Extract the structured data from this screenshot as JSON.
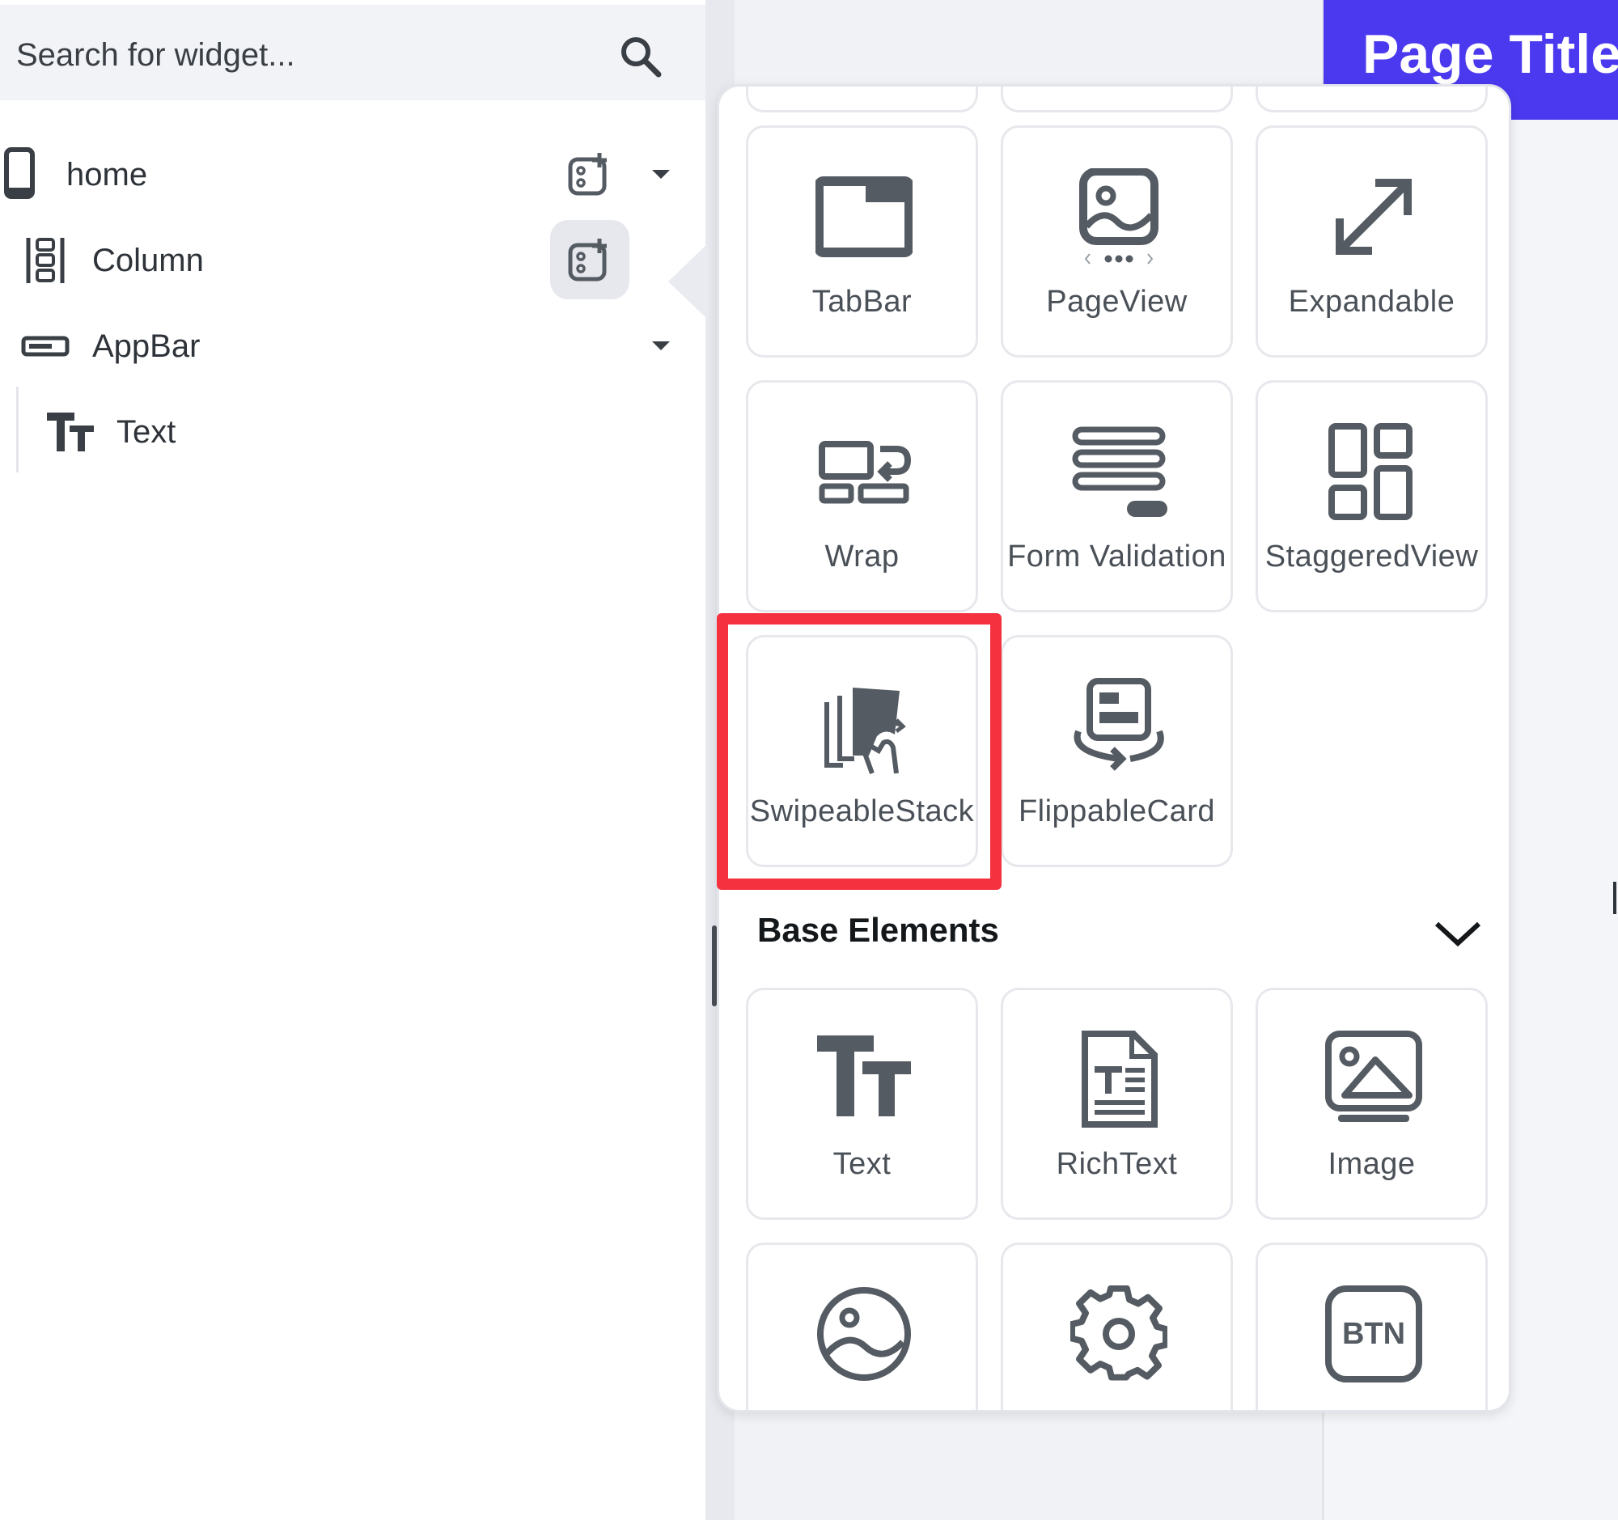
{
  "search": {
    "placeholder": "Search for widget..."
  },
  "tree": {
    "items": [
      {
        "label": "home",
        "icon": "phone-icon",
        "has_add": true,
        "has_caret": true
      },
      {
        "label": "Column",
        "icon": "column-icon",
        "has_add": true,
        "add_active": true
      },
      {
        "label": "AppBar",
        "icon": "appbar-icon",
        "has_caret": true
      },
      {
        "label": "Text",
        "icon": "text-icon"
      }
    ]
  },
  "canvas": {
    "page_title": "Page Title",
    "app_bar_color": "#4b39ef"
  },
  "palette": {
    "layout_tiles": [
      {
        "label": "TabBar",
        "icon": "tabbar-icon"
      },
      {
        "label": "PageView",
        "icon": "pageview-icon"
      },
      {
        "label": "Expandable",
        "icon": "expand-icon"
      },
      {
        "label": "Wrap",
        "icon": "wrap-icon"
      },
      {
        "label": "Form Validation",
        "icon": "form-validation-icon"
      },
      {
        "label": "StaggeredView",
        "icon": "staggered-view-icon"
      },
      {
        "label": "SwipeableStack",
        "icon": "swipeable-stack-icon",
        "highlighted": true
      },
      {
        "label": "FlippableCard",
        "icon": "flippable-card-icon"
      }
    ],
    "section": {
      "title": "Base Elements",
      "icon": "chevron-down-icon"
    },
    "base_tiles": [
      {
        "label": "Text",
        "icon": "text-icon"
      },
      {
        "label": "RichText",
        "icon": "rich-text-icon"
      },
      {
        "label": "Image",
        "icon": "image-icon"
      }
    ],
    "partial_tiles": [
      {
        "icon": "circle-image-icon"
      },
      {
        "icon": "gear-icon"
      },
      {
        "icon": "button-icon",
        "text": "BTN"
      }
    ]
  },
  "colors": {
    "highlight": "#f5303f",
    "accent": "#4b39ef",
    "icon": "#555b62"
  }
}
